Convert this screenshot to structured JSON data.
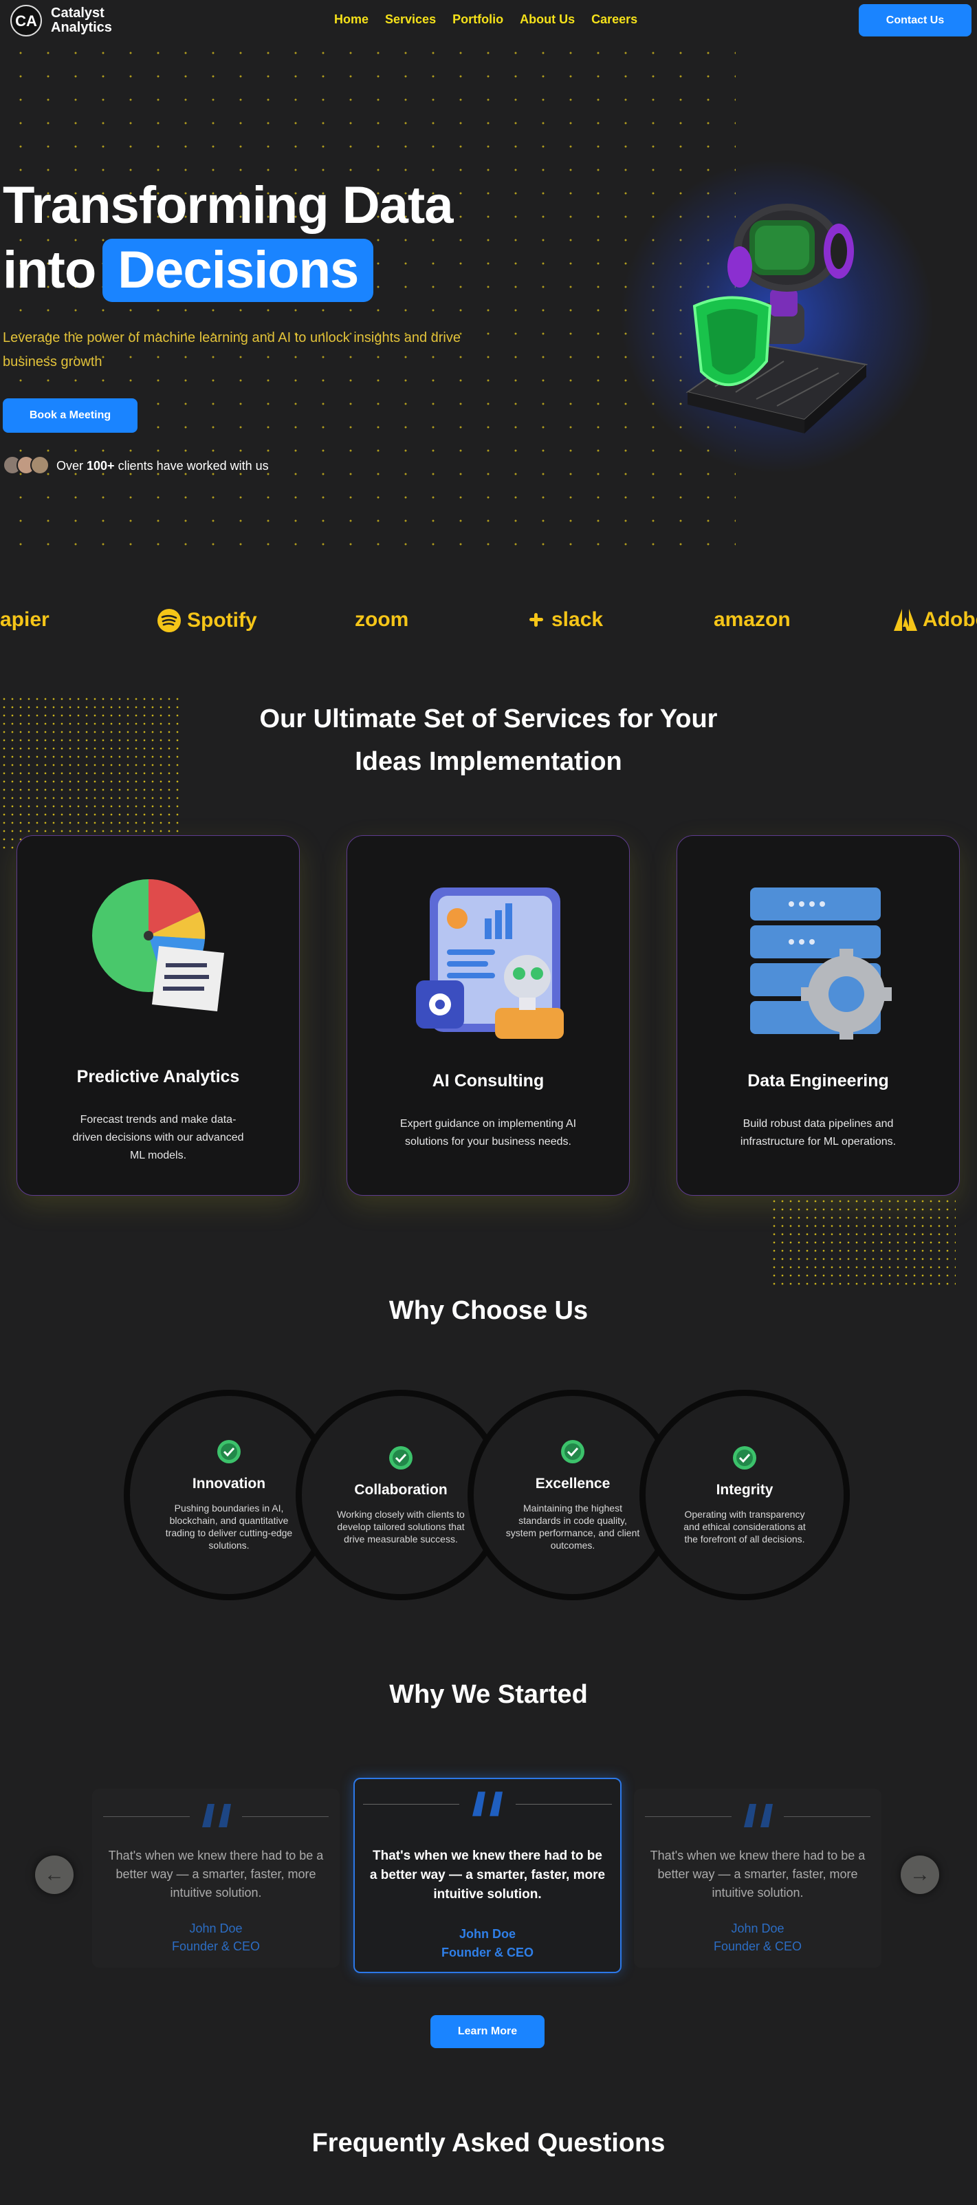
{
  "brand": {
    "name_line1": "Catalyst",
    "name_line2": "Analytics",
    "logo_letters": "CA"
  },
  "nav": {
    "items": [
      "Home",
      "Services",
      "Portfolio",
      "About Us",
      "Careers"
    ],
    "contact_label": "Contact Us"
  },
  "hero": {
    "title_line1": "Transforming Data",
    "title_line2_plain": "into",
    "title_line2_highlight": "Decisions",
    "subtitle": "Leverage the power of machine learning and AI to unlock insights and drive business growth",
    "cta_label": "Book a Meeting",
    "clients_prefix": "Over ",
    "clients_count": "100+",
    "clients_suffix": " clients have worked with us"
  },
  "logos": [
    "apier",
    "Spotify",
    "zoom",
    "slack",
    "amazon",
    "Adobe"
  ],
  "services": {
    "title_line1": "Our Ultimate Set of Services for Your",
    "title_line2": "Ideas Implementation",
    "cards": [
      {
        "title": "Predictive Analytics",
        "desc": "Forecast trends and make data-driven decisions with our advanced ML models.",
        "icon": "pie-chart-icon"
      },
      {
        "title": "AI Consulting",
        "desc": "Expert guidance on implementing AI solutions for your business needs.",
        "icon": "ai-robot-icon"
      },
      {
        "title": "Data Engineering",
        "desc": "Build robust data pipelines and infrastructure for ML operations.",
        "icon": "server-gear-icon"
      }
    ]
  },
  "why_choose": {
    "title": "Why Choose Us",
    "items": [
      {
        "title": "Innovation",
        "desc": "Pushing boundaries in AI, blockchain, and quantitative trading to deliver cutting-edge solutions."
      },
      {
        "title": "Collaboration",
        "desc": "Working closely with clients to develop tailored solutions that drive measurable success."
      },
      {
        "title": "Excellence",
        "desc": "Maintaining the highest standards in code quality, system performance, and client outcomes."
      },
      {
        "title": "Integrity",
        "desc": "Operating with transparency and ethical considerations at the forefront of all decisions."
      }
    ]
  },
  "why_started": {
    "title": "Why We Started",
    "testimonials": [
      {
        "quote": "That's when we knew there had to be a better way — a smarter, faster, more intuitive solution.",
        "name": "John Doe",
        "role": "Founder & CEO"
      },
      {
        "quote": "That's when we knew there had to be a better way — a smarter, faster, more intuitive solution.",
        "name": "John Doe",
        "role": "Founder & CEO"
      },
      {
        "quote": "That's when we knew there had to be a better way — a smarter, faster, more intuitive solution.",
        "name": "John Doe",
        "role": "Founder & CEO"
      }
    ],
    "prev_arrow": "←",
    "next_arrow": "→",
    "cta_label": "Learn More"
  },
  "faq": {
    "title": "Frequently Asked Questions"
  },
  "colors": {
    "accent": "#1a84ff",
    "nav_yellow": "#f5e11a",
    "background": "#1f1f20",
    "card_border": "#5e3b8f",
    "check_green": "#3cc26b"
  }
}
